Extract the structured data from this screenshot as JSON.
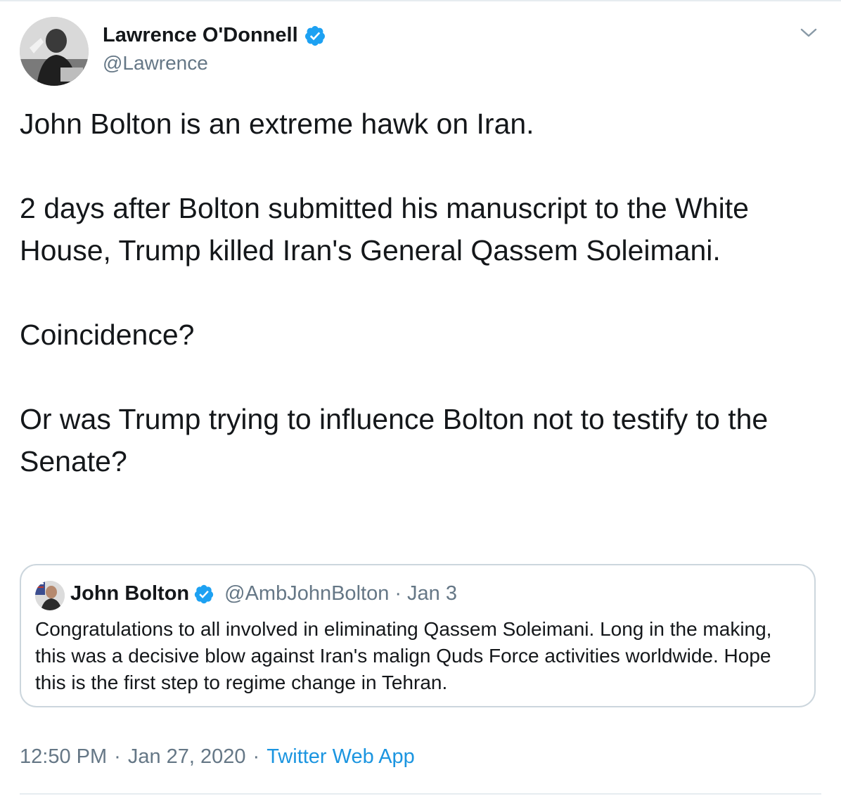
{
  "tweet": {
    "author": {
      "name": "Lawrence O'Donnell",
      "handle": "@Lawrence",
      "verified": true,
      "avatar_icon": "profile-photo"
    },
    "menu_icon": "chevron-down-icon",
    "paragraphs": [
      "John Bolton is an extreme hawk on Iran.",
      "2 days after Bolton submitted his manuscript to the White House, Trump killed Iran's General Qassem Soleimani.",
      "Coincidence?",
      "Or was Trump trying to influence Bolton not to testify to the Senate?"
    ],
    "quoted": {
      "name": "John Bolton",
      "handle": "@AmbJohnBolton",
      "separator": "·",
      "date": "Jan 3",
      "verified": true,
      "text": "Congratulations to all involved in eliminating Qassem Soleimani.  Long in the making, this was a decisive blow against Iran's malign Quds Force activities worldwide.  Hope this is the first step to regime change in Tehran."
    },
    "meta": {
      "time": "12:50 PM",
      "separator": "·",
      "date": "Jan 27, 2020",
      "source": "Twitter Web App"
    }
  },
  "colors": {
    "text": "#14171a",
    "secondary": "#657786",
    "link": "#1b95e0",
    "verified": "#1da1f2",
    "border": "#ccd6dd"
  }
}
